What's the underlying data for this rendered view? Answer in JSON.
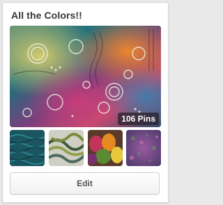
{
  "board": {
    "title": "All the Colors!!",
    "pin_count": "106 Pins",
    "edit_label": "Edit"
  },
  "colors": {
    "background": "#e9e9e9",
    "card": "#ffffff",
    "title_text": "#363636",
    "button_text": "#555555"
  }
}
